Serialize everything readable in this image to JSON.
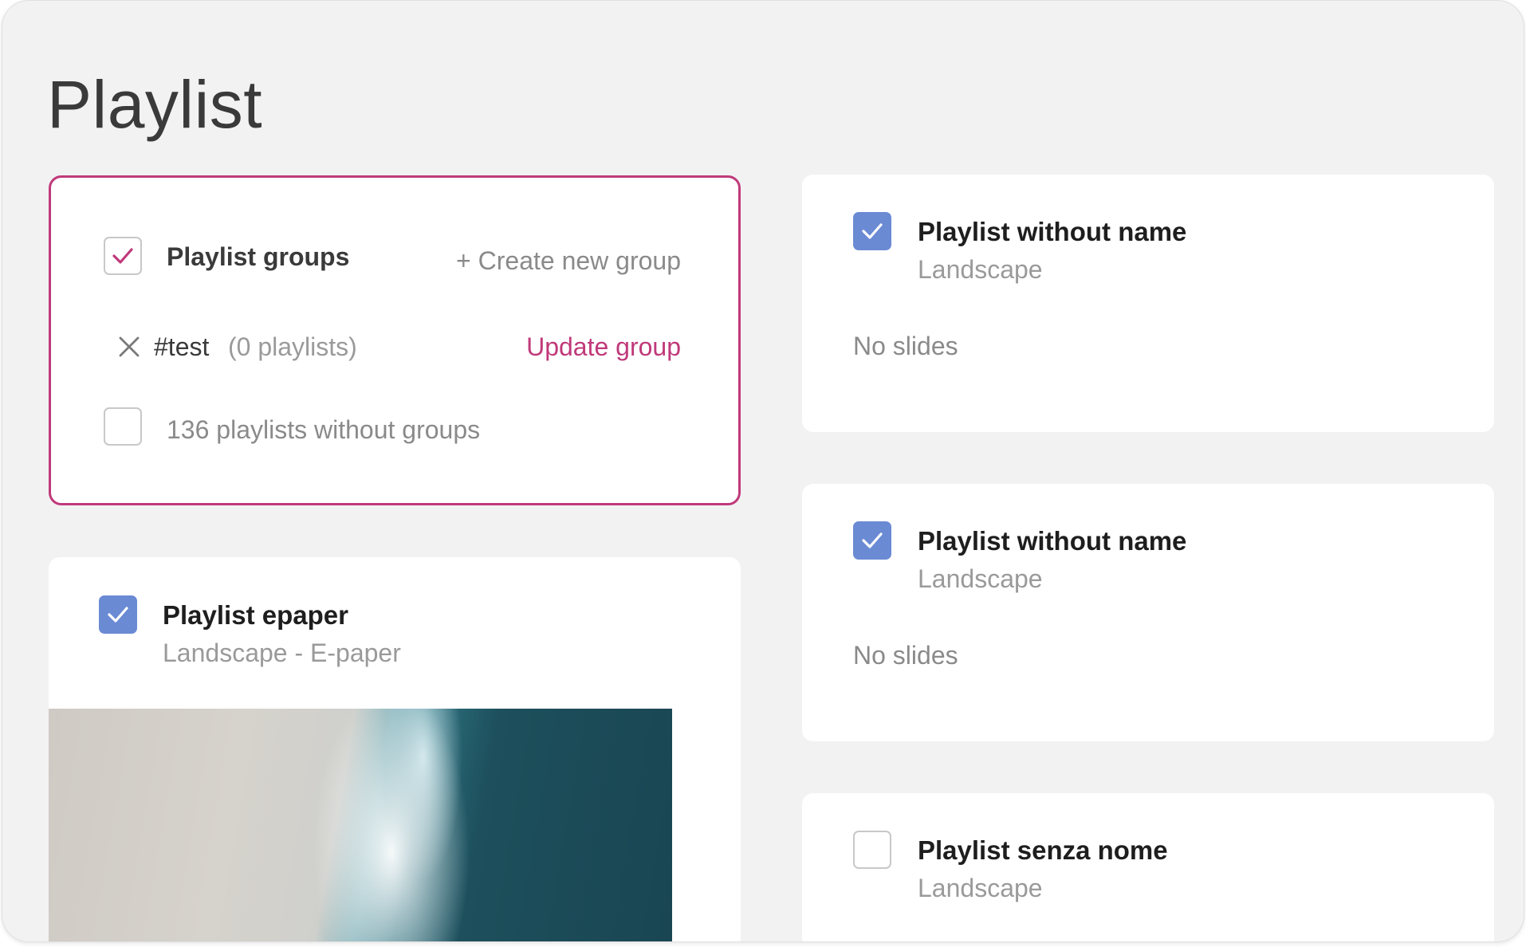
{
  "page": {
    "title": "Playlist"
  },
  "groups": {
    "title": "Playlist groups",
    "create_label": "+ Create new group",
    "tag_name": "#test",
    "tag_count": "(0 playlists)",
    "update_label": "Update group",
    "ungrouped_label": "136 playlists without groups"
  },
  "playlists": [
    {
      "title": "Playlist epaper",
      "subtitle": "Landscape - E-paper",
      "checked": true
    },
    {
      "title": "Playlist without name",
      "subtitle": "Landscape",
      "status": "No slides",
      "checked": true
    },
    {
      "title": "Playlist without name",
      "subtitle": "Landscape",
      "status": "No slides",
      "checked": true
    },
    {
      "title": "Playlist senza nome",
      "subtitle": "Landscape",
      "checked": false
    }
  ],
  "colors": {
    "accent": "#c0397a",
    "checkbox_checked": "#6b8ad4",
    "background": "#f2f2f2"
  }
}
